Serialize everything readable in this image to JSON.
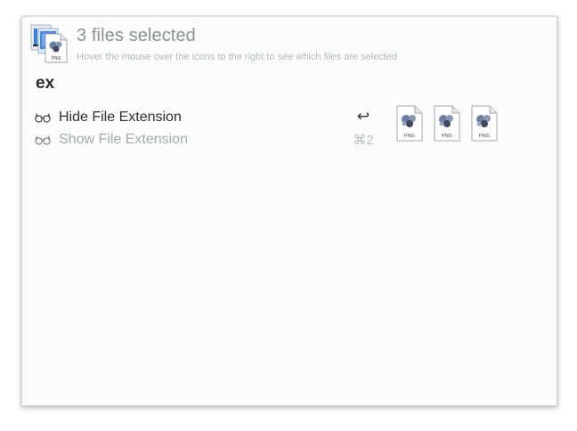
{
  "header": {
    "title": "3 files selected",
    "subtitle": "Hover the mouse over the icons to the right to see which files are selected",
    "icon": "stacked-png-files-icon"
  },
  "query": "ex",
  "actions": [
    {
      "label": "Hide File Extension",
      "shortcut": "↩",
      "icon": "glasses-icon",
      "selected": true
    },
    {
      "label": "Show File Extension",
      "shortcut": "⌘2",
      "icon": "glasses-icon",
      "selected": false
    }
  ],
  "files": [
    {
      "type_label": "PNG",
      "icon": "png-file-icon"
    },
    {
      "type_label": "PNG",
      "icon": "png-file-icon"
    },
    {
      "type_label": "PNG",
      "icon": "png-file-icon"
    }
  ],
  "colors": {
    "panel_background": "#fbfdfc",
    "title_gray": "#8d9196",
    "selected_text": "#2e2e2e",
    "unselected_text": "#a5aaae"
  }
}
